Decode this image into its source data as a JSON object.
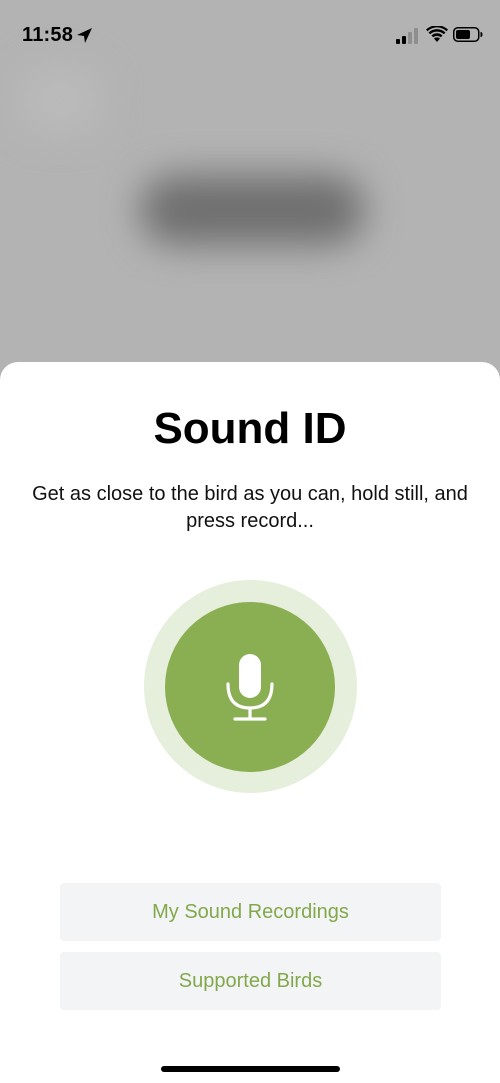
{
  "status_bar": {
    "time": "11:58",
    "icons": [
      "location-arrow-icon",
      "cellular-signal-icon",
      "wifi-icon",
      "battery-icon"
    ]
  },
  "sheet": {
    "title": "Sound ID",
    "subtitle": "Get as close to the bird as you can, hold still, and press record...",
    "record_button_icon": "microphone-icon"
  },
  "buttons": {
    "recordings_label": "My Sound Recordings",
    "supported_birds_label": "Supported Birds"
  },
  "colors": {
    "accent": "#8aae52",
    "halo": "#e6eedc",
    "button_text": "#83a84c",
    "button_bg": "#f3f4f5",
    "backdrop": "#b3b3b3"
  }
}
